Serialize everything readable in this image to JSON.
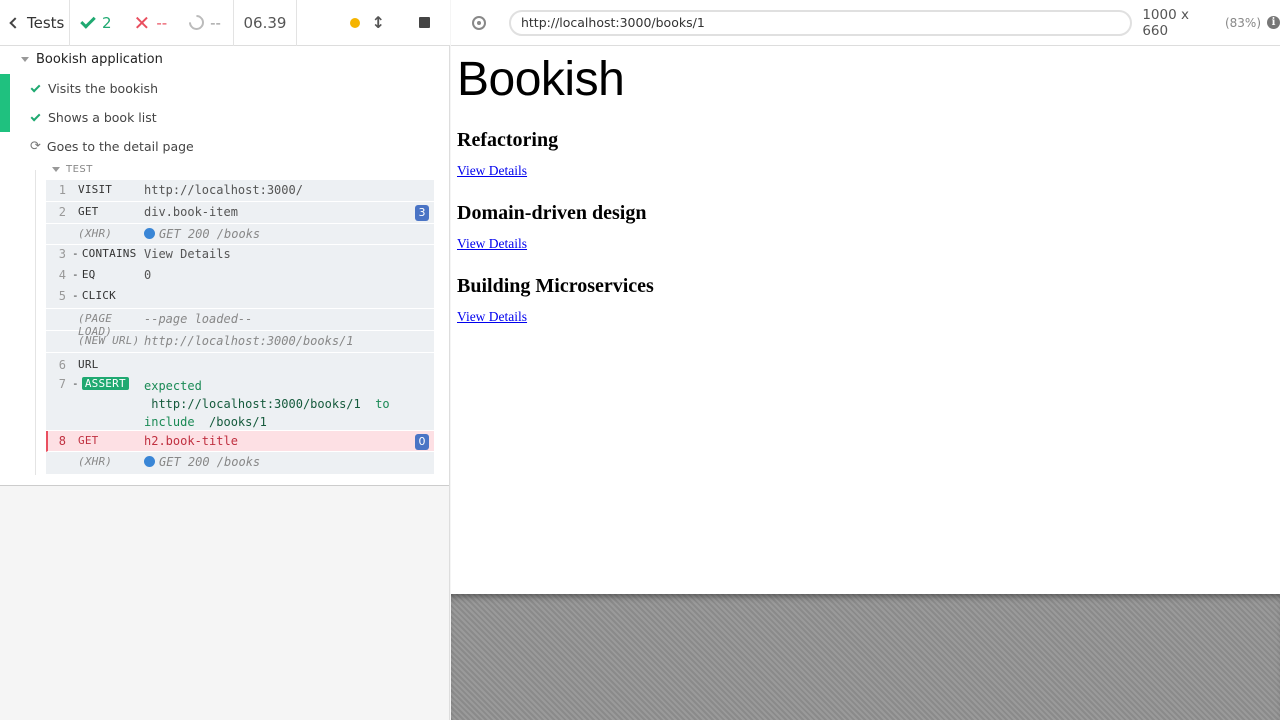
{
  "reporter": {
    "tests_label": "Tests",
    "stats": {
      "passed": "2",
      "failed": "--",
      "pending": "--"
    },
    "duration": "06.39",
    "suite": {
      "title": "Bookish application",
      "tests": [
        {
          "title": "Visits the bookish",
          "state": "passed"
        },
        {
          "title": "Shows a book list",
          "state": "passed"
        },
        {
          "title": "Goes to the detail page",
          "state": "running"
        }
      ]
    },
    "test_header": "TEST",
    "commands": [
      {
        "num": "1",
        "name": "visit",
        "msg": "http://localhost:3000/"
      },
      {
        "num": "2",
        "name": "get",
        "msg": "div.book-item",
        "badge": "3"
      },
      {
        "num": "",
        "name": "(XHR)",
        "msg": "GET 200 /books"
      },
      {
        "num": "3",
        "name": "contains",
        "msg": "View Details"
      },
      {
        "num": "4",
        "name": "eq",
        "msg": "0"
      },
      {
        "num": "5",
        "name": "click",
        "msg": ""
      },
      {
        "num": "",
        "name": "(PAGE LOAD)",
        "msg": "--page loaded--"
      },
      {
        "num": "",
        "name": "(NEW URL)",
        "msg": "http://localhost:3000/books/1"
      },
      {
        "num": "6",
        "name": "url",
        "msg": ""
      },
      {
        "num": "7",
        "name": "assert",
        "msg_expected": "expected",
        "msg_url": "http://localhost:3000/books/1",
        "msg_to": "to",
        "msg_include": "include",
        "msg_value": "/books/1"
      },
      {
        "num": "8",
        "name": "get",
        "msg": "h2.book-title",
        "badge": "0"
      },
      {
        "num": "",
        "name": "(XHR)",
        "msg": "GET 200 /books"
      }
    ]
  },
  "aut": {
    "url": "http://localhost:3000/books/1",
    "viewport": "1000 x 660",
    "scale": "(83%)",
    "app": {
      "title": "Bookish",
      "books": [
        {
          "title": "Refactoring",
          "link": "View Details"
        },
        {
          "title": "Domain-driven design",
          "link": "View Details"
        },
        {
          "title": "Building Microservices",
          "link": "View Details"
        }
      ]
    }
  }
}
